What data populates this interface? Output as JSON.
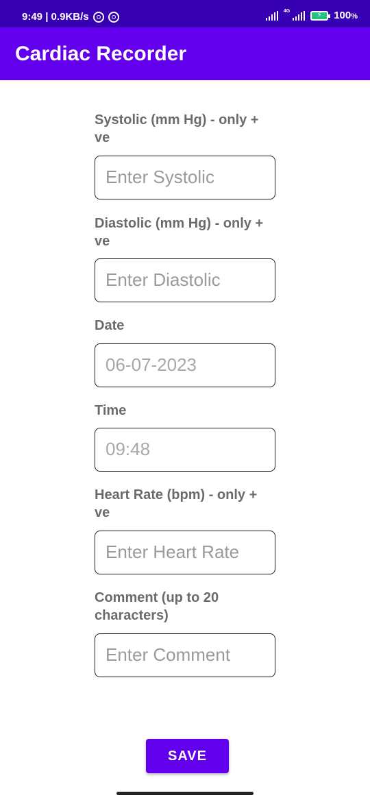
{
  "status_bar": {
    "time_speed": "9:49 | 0.9KB/s",
    "network_type": "4G",
    "battery": "100",
    "battery_unit": "%"
  },
  "app_bar": {
    "title": "Cardiac Recorder"
  },
  "form": {
    "systolic": {
      "label": "Systolic (mm Hg) - only +\nve",
      "placeholder": "Enter Systolic",
      "value": ""
    },
    "diastolic": {
      "label": "Diastolic (mm Hg) - only +\nve",
      "placeholder": "Enter Diastolic",
      "value": ""
    },
    "date": {
      "label": "Date",
      "value": "06-07-2023"
    },
    "time": {
      "label": "Time",
      "value": "09:48"
    },
    "heart_rate": {
      "label": "Heart Rate (bpm) - only +\nve",
      "placeholder": "Enter Heart Rate",
      "value": ""
    },
    "comment": {
      "label": "Comment (up to 20\ncharacters)",
      "placeholder": "Enter Comment",
      "value": ""
    }
  },
  "actions": {
    "save_label": "SAVE"
  },
  "colors": {
    "primary": "#6200ee",
    "primary_dark": "#3700b3",
    "label": "#6b6b6b"
  }
}
